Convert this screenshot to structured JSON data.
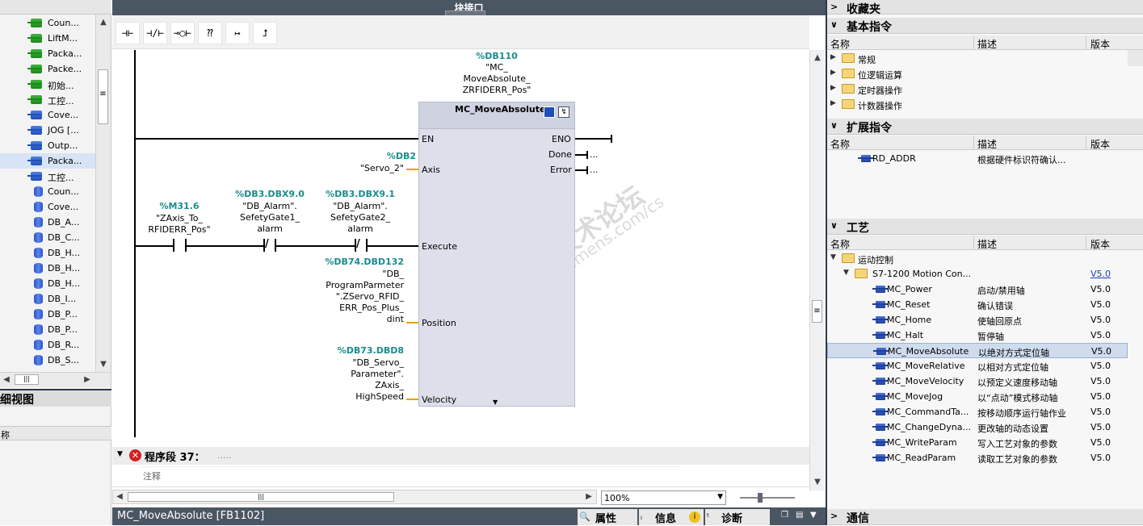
{
  "window": {
    "title": "块接口"
  },
  "left_tree": {
    "items": [
      {
        "label": "Coun...",
        "icon": "green-fb-icon"
      },
      {
        "label": "LiftM...",
        "icon": "green-fb-icon"
      },
      {
        "label": "Packa...",
        "icon": "green-fb-icon"
      },
      {
        "label": "Packe...",
        "icon": "green-fb-icon"
      },
      {
        "label": "初始...",
        "icon": "green-fb-icon"
      },
      {
        "label": "工控...",
        "icon": "green-fb-icon"
      },
      {
        "label": "Cove...",
        "icon": "blue-fb-icon"
      },
      {
        "label": "JOG [...",
        "icon": "blue-fb-icon"
      },
      {
        "label": "Outp...",
        "icon": "blue-fb-icon"
      },
      {
        "label": "Packa...",
        "icon": "blue-fb-icon"
      },
      {
        "label": "工控...",
        "icon": "blue-fb-icon"
      },
      {
        "label": "Coun...",
        "icon": "db-icon"
      },
      {
        "label": "Cove...",
        "icon": "db-icon"
      },
      {
        "label": "DB_A...",
        "icon": "db-icon"
      },
      {
        "label": "DB_C...",
        "icon": "db-icon"
      },
      {
        "label": "DB_H...",
        "icon": "db-icon"
      },
      {
        "label": "DB_H...",
        "icon": "db-icon"
      },
      {
        "label": "DB_H...",
        "icon": "db-icon"
      },
      {
        "label": "DB_I...",
        "icon": "db-icon"
      },
      {
        "label": "DB_P...",
        "icon": "db-icon"
      },
      {
        "label": "DB_P...",
        "icon": "db-icon"
      },
      {
        "label": "DB_R...",
        "icon": "db-icon"
      },
      {
        "label": "DB_S...",
        "icon": "db-icon"
      }
    ],
    "selected_index": 9
  },
  "detail_view": {
    "title": "详细视图",
    "column": "名称"
  },
  "toolbar": {
    "buttons": [
      "⊣⊢",
      "⊣/⊢",
      "⊸○⊢",
      "⁇",
      "↦",
      "⮥"
    ]
  },
  "ladder": {
    "instance_db": "%DB110",
    "instance_name_lines": [
      "\"MC_",
      "MoveAbsolute_",
      "ZRFIDERR_Pos\""
    ],
    "block_name": "MC_MoveAbsolute",
    "pins": {
      "en": "EN",
      "eno": "ENO",
      "axis": "Axis",
      "done": "Done",
      "error": "Error",
      "execute": "Execute",
      "position": "Position",
      "velocity": "Velocity",
      "done_dots": "...",
      "error_dots": "..."
    },
    "axis_addr": "%DB2",
    "axis_name": "\"Servo_2\"",
    "contacts": [
      {
        "addr": "%M31.6",
        "lines": [
          "\"ZAxis_To_",
          "RFIDERR_Pos\""
        ]
      },
      {
        "addr": "%DB3.DBX9.0",
        "lines": [
          "\"DB_Alarm\".",
          "SefetyGate1_",
          "alarm"
        ]
      },
      {
        "addr": "%DB3.DBX9.1",
        "lines": [
          "\"DB_Alarm\".",
          "SefetyGate2_",
          "alarm"
        ]
      }
    ],
    "position_addr": "%DB74.DBD132",
    "position_lines": [
      "\"DB_",
      "ProgramParmeter",
      "\".ZServo_RFID_",
      "ERR_Pos_Plus_",
      "dint"
    ],
    "velocity_addr": "%DB73.DBD8",
    "velocity_lines": [
      "\"DB_Servo_",
      "Parameter\".",
      "ZAxis_",
      "HighSpeed"
    ]
  },
  "segment": {
    "title": "程序段 37：",
    "dots": ".....",
    "comment": "注释"
  },
  "zoom": {
    "value": "100%"
  },
  "bottom_bar": {
    "block": "MC_MoveAbsolute [FB1102]",
    "tabs": [
      "属性",
      "信息",
      "诊断"
    ]
  },
  "watermark": {
    "line1": "西门子工业 技术论坛",
    "line2": "support.industry.siemens.com/cs"
  },
  "right_panel": {
    "favorites": "收藏夹",
    "basic": {
      "title": "基本指令",
      "cols": [
        "名称",
        "描述",
        "版本"
      ],
      "items": [
        "常规",
        "位逻辑运算",
        "定时器操作",
        "计数器操作"
      ]
    },
    "extended": {
      "title": "扩展指令",
      "cols": [
        "名称",
        "描述",
        "版本"
      ],
      "items": [
        {
          "name": "RD_ADDR",
          "desc": "根据硬件标识符确认..."
        }
      ]
    },
    "technology": {
      "title": "工艺",
      "cols": [
        "名称",
        "描述",
        "版本"
      ],
      "folder": "运动控制",
      "subfolder": "S7-1200 Motion Con...",
      "subfolder_version": "V5.0",
      "items": [
        {
          "name": "MC_Power",
          "desc": "启动/禁用轴",
          "ver": "V5.0"
        },
        {
          "name": "MC_Reset",
          "desc": "确认错误",
          "ver": "V5.0"
        },
        {
          "name": "MC_Home",
          "desc": "使轴回原点",
          "ver": "V5.0"
        },
        {
          "name": "MC_Halt",
          "desc": "暂停轴",
          "ver": "V5.0"
        },
        {
          "name": "MC_MoveAbsolute",
          "desc": "以绝对方式定位轴",
          "ver": "V5.0"
        },
        {
          "name": "MC_MoveRelative",
          "desc": "以相对方式定位轴",
          "ver": "V5.0"
        },
        {
          "name": "MC_MoveVelocity",
          "desc": "以预定义速度移动轴",
          "ver": "V5.0"
        },
        {
          "name": "MC_MoveJog",
          "desc": "以“点动”模式移动轴",
          "ver": "V5.0"
        },
        {
          "name": "MC_CommandTa...",
          "desc": "按移动顺序运行轴作业",
          "ver": "V5.0"
        },
        {
          "name": "MC_ChangeDyna...",
          "desc": "更改轴的动态设置",
          "ver": "V5.0"
        },
        {
          "name": "MC_WriteParam",
          "desc": "写入工艺对象的参数",
          "ver": "V5.0"
        },
        {
          "name": "MC_ReadParam",
          "desc": "读取工艺对象的参数",
          "ver": "V5.0"
        }
      ],
      "selected_index": 4
    },
    "communication": "通信"
  }
}
